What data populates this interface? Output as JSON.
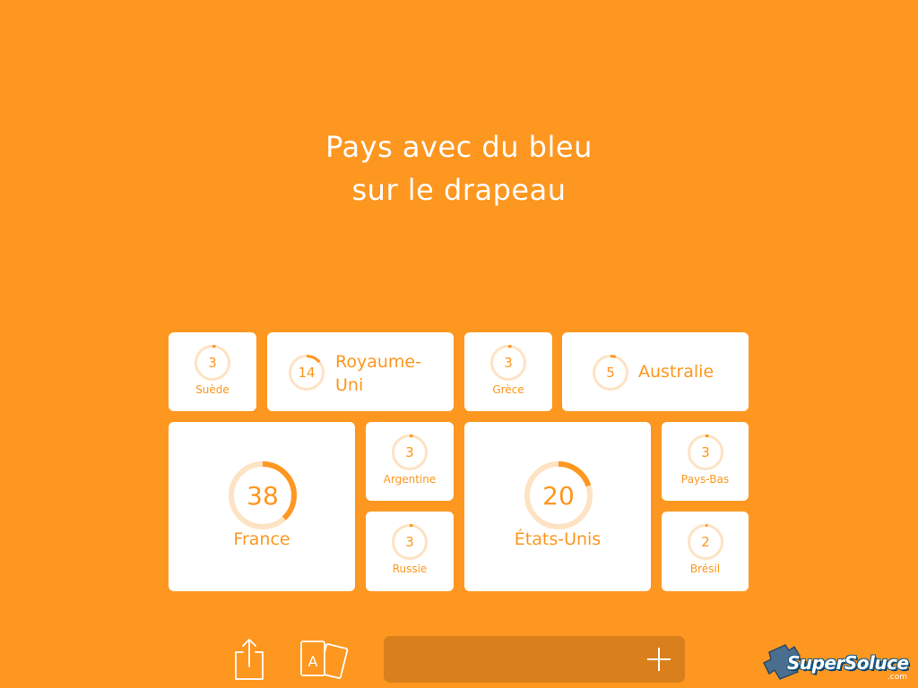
{
  "question": {
    "line1": "Pays avec du bleu",
    "line2": "sur le drapeau"
  },
  "answers": [
    {
      "id": "suede",
      "label": "Suède",
      "points": 3,
      "fraction": 0.03
    },
    {
      "id": "royaume-uni",
      "label_line1": "Royaume-",
      "label_line2": "Uni",
      "points": 14,
      "fraction": 0.14
    },
    {
      "id": "grece",
      "label": "Grèce",
      "points": 3,
      "fraction": 0.03
    },
    {
      "id": "australie",
      "label": "Australie",
      "points": 5,
      "fraction": 0.05
    },
    {
      "id": "france",
      "label": "France",
      "points": 38,
      "fraction": 0.38
    },
    {
      "id": "argentine",
      "label": "Argentine",
      "points": 3,
      "fraction": 0.03
    },
    {
      "id": "russie",
      "label": "Russie",
      "points": 3,
      "fraction": 0.03
    },
    {
      "id": "etats-unis",
      "label": "États-Unis",
      "points": 20,
      "fraction": 0.2
    },
    {
      "id": "pays-bas",
      "label": "Pays-Bas",
      "points": 3,
      "fraction": 0.03
    },
    {
      "id": "bresil",
      "label": "Brésil",
      "points": 2,
      "fraction": 0.02
    }
  ],
  "colors": {
    "background": "#fd9720",
    "tile": "#ffffff",
    "accent": "#fd9720",
    "ring_track": "#fde3c4",
    "input_bar": "#d9801c"
  },
  "toolbar": {
    "share_icon": "share-icon",
    "cards_icon": "cards-icon",
    "cards_letter": "A",
    "plus_icon": "plus-icon"
  },
  "logo": {
    "text": "SuperSoluce",
    "sub": ".com"
  }
}
